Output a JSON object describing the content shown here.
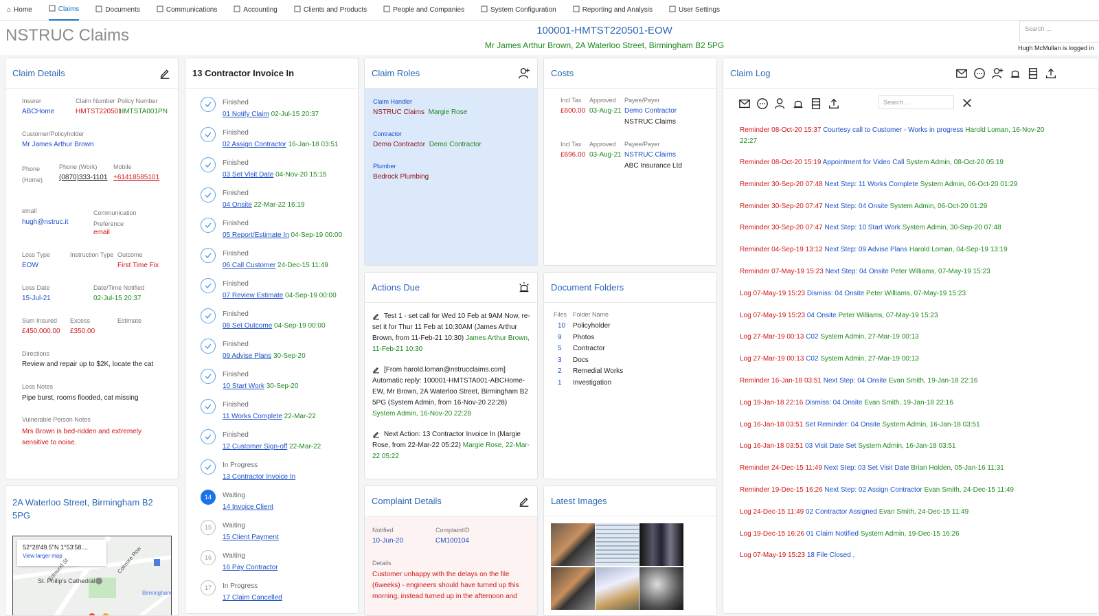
{
  "nav": [
    {
      "label": "Home",
      "icon": "home-icon"
    },
    {
      "label": "Claims",
      "icon": "claims-icon"
    },
    {
      "label": "Documents",
      "icon": "documents-icon"
    },
    {
      "label": "Communications",
      "icon": "communications-icon"
    },
    {
      "label": "Accounting",
      "icon": "accounting-icon"
    },
    {
      "label": "Clients and Products",
      "icon": "clients-icon"
    },
    {
      "label": "People and Companies",
      "icon": "people-icon"
    },
    {
      "label": "System Configuration",
      "icon": "gear-icon"
    },
    {
      "label": "Reporting and Analysis",
      "icon": "chart-icon"
    },
    {
      "label": "User Settings",
      "icon": "gear-icon"
    }
  ],
  "header": {
    "app_title": "NSTRUC Claims",
    "claim_id": "100001-HMTST220501-EOW",
    "claim_address": "Mr James Arthur Brown, 2A Waterloo Street, Birmingham B2 5PG",
    "search_placeholder": "Search ...",
    "logged_in": "Hugh McMullan is logged in"
  },
  "claim_details": {
    "title": "Claim Details",
    "insurer_label": "Insurer",
    "insurer": "ABCHome",
    "claim_number_label": "Claim Number",
    "claim_number": "HMTST220501",
    "policy_number_label": "Policy Number",
    "policy_number": "HMTSTA001PN",
    "customer_label": "Customer/Policyholder",
    "customer": "Mr James Arthur Brown",
    "phone_home_label": "Phone (Home)",
    "phone_work_label": "Phone (Work)",
    "phone_work": "(0870)333-1101",
    "mobile_label": "Mobile",
    "mobile": "+61418585101",
    "email_label": "email",
    "email": "hugh@nstruc.it",
    "comm_pref_label": "Communication Preference",
    "comm_pref": "email",
    "loss_type_label": "Loss Type",
    "loss_type": "EOW",
    "instruction_label": "Instruction Type",
    "outcome_label": "Outcome",
    "outcome": "First Time Fix",
    "loss_date_label": "Loss Date",
    "loss_date": "15-Jul-21",
    "notified_label": "Date/Time Notified",
    "notified": "02-Jul-15 20:37",
    "sum_insured_label": "Sum Insured",
    "sum_insured": "£450,000.00",
    "excess_label": "Excess",
    "excess": "£350.00",
    "estimate_label": "Estimate",
    "directions_label": "Directions",
    "directions": "Review and repair up to $2K, locate the cat",
    "loss_notes_label": "Loss Notes",
    "loss_notes": "Pipe burst, rooms flooded, cat missing",
    "vuln_label": "Vulnerable Person Notes",
    "vuln": "Mrs Brown is bed-ridden and extremely sensitive to noise."
  },
  "address_panel": {
    "title": "2A Waterloo Street, Birmingham B2 5PG",
    "coords": "52°28'49.5\"N 1°53'58....",
    "larger_map": "View larger map",
    "map_label_1": "Colmore Row",
    "map_label_2": "St. Philip's Cathedral",
    "map_label_3": "Birmingham",
    "map_label_4": "Edmund St"
  },
  "workflow": {
    "title": "13 Contractor Invoice In",
    "steps": [
      {
        "status": "Finished",
        "name": "01 Notify Claim",
        "date": "02-Jul-15 20:37"
      },
      {
        "status": "Finished",
        "name": "02 Assign Contractor",
        "date": "16-Jan-18 03:51"
      },
      {
        "status": "Finished",
        "name": "03 Set Visit Date",
        "date": "04-Nov-20 15:15"
      },
      {
        "status": "Finished",
        "name": "04 Onsite",
        "date": "22-Mar-22 16:19"
      },
      {
        "status": "Finished",
        "name": "05 Report/Estimate In",
        "date": "04-Sep-19 00:00"
      },
      {
        "status": "Finished",
        "name": "06 Call Customer",
        "date": "24-Dec-15 11:49"
      },
      {
        "status": "Finished",
        "name": "07 Review Estimate",
        "date": "04-Sep-19 00:00"
      },
      {
        "status": "Finished",
        "name": "08 Set Outcome",
        "date": "04-Sep-19 00:00"
      },
      {
        "status": "Finished",
        "name": "09 Advise Plans",
        "date": "30-Sep-20"
      },
      {
        "status": "Finished",
        "name": "10 Start Work",
        "date": "30-Sep-20"
      },
      {
        "status": "Finished",
        "name": "11 Works Complete",
        "date": "22-Mar-22"
      },
      {
        "status": "Finished",
        "name": "12 Customer Sign-off",
        "date": "22-Mar-22"
      },
      {
        "status": "In Progress",
        "name": "13 Contractor Invoice In",
        "date": ""
      },
      {
        "status": "Waiting",
        "name": "14 Invoice Client",
        "date": "",
        "num": "14"
      },
      {
        "status": "Waiting",
        "name": "15 Client Payment",
        "date": "",
        "num": "15"
      },
      {
        "status": "Waiting",
        "name": "16 Pay Contractor",
        "date": "",
        "num": "16"
      },
      {
        "status": "In Progress",
        "name": "17 Claim Cancelled",
        "date": "",
        "num": "17"
      }
    ]
  },
  "claim_roles": {
    "title": "Claim Roles",
    "roles": [
      {
        "role": "Claim Handler",
        "org": "NSTRUC Claims",
        "person": "Margie Rose"
      },
      {
        "role": "Contractor",
        "org": "Demo Contractor",
        "person": "Demo Contractor"
      },
      {
        "role": "Plumber",
        "org": "Bedrock Plumbing",
        "person": ""
      }
    ]
  },
  "costs": {
    "title": "Costs",
    "incl_tax_label": "Incl Tax",
    "approved_label": "Approved",
    "payee_label": "Payee/Payer",
    "items": [
      {
        "amount": "£600.00",
        "approved": "03-Aug-21",
        "payee": "Demo Contractor",
        "payer": "NSTRUC Claims"
      },
      {
        "amount": "£696.00",
        "approved": "03-Aug-21",
        "payee": "NSTRUC Claims",
        "payer": "ABC Insurance Ltd"
      }
    ]
  },
  "actions_due": {
    "title": "Actions Due",
    "items": [
      {
        "text": "Test 1 - set call for Wed 10 Feb at 9AM Now, re-set it for Thur 11 Feb at 10:30AM (James Arthur Brown, from 11-Feb-21 10:30)",
        "tail": "James Arthur Brown, 11-Feb-21 10:30"
      },
      {
        "text": "[From harold.loman@nstrucclaims.com] Automatic reply: 100001-HMTSTA001-ABCHome-EW, Mr Brown, 2A Waterloo Street, Birmingham B2 5PG (System Admin, from 16-Nov-20 22:28)",
        "tail": "System Admin, 16-Nov-20 22:28"
      },
      {
        "text": "Next Action: 13 Contractor Invoice In (Margie Rose, from 22-Mar-22 05:22)",
        "tail": "Margie Rose, 22-Mar-22 05:22"
      }
    ]
  },
  "document_folders": {
    "title": "Document Folders",
    "files_label": "Files",
    "folder_label": "Folder Name",
    "rows": [
      {
        "count": "10",
        "name": "Policyholder"
      },
      {
        "count": "9",
        "name": "Photos"
      },
      {
        "count": "5",
        "name": "Contractor"
      },
      {
        "count": "3",
        "name": "Docs"
      },
      {
        "count": "2",
        "name": "Remedial Works"
      },
      {
        "count": "1",
        "name": "Investigation"
      }
    ]
  },
  "complaint": {
    "title": "Complaint Details",
    "notified_label": "Notified",
    "notified": "10-Jun-20",
    "id_label": "ComplaintID",
    "id": "CM100104",
    "details_label": "Details",
    "details": "Customer unhappy with the delays on the file (6weeks) - engineers should have turned up this morning, instead turned up in the afternoon and"
  },
  "latest_images": {
    "title": "Latest Images"
  },
  "claim_log": {
    "title": "Claim Log",
    "search_placeholder": "Search ...",
    "entries": [
      {
        "type": "Reminder",
        "time": "08-Oct-20 15:37",
        "desc": "Courtesy call to Customer - Works in progress",
        "by": "Harold Loman, 16-Nov-20 22:27"
      },
      {
        "type": "Reminder",
        "time": "08-Oct-20 15:19",
        "desc": "Appointment for Video Call",
        "by": "System Admin, 08-Oct-20 05:19"
      },
      {
        "type": "Reminder",
        "time": "30-Sep-20 07:48",
        "desc": "Next Step: 11 Works Complete",
        "by": "System Admin, 06-Oct-20 01:29"
      },
      {
        "type": "Reminder",
        "time": "30-Sep-20 07:47",
        "desc": "Next Step: 04 Onsite",
        "by": "System Admin, 06-Oct-20 01:29"
      },
      {
        "type": "Reminder",
        "time": "30-Sep-20 07:47",
        "desc": "Next Step: 10 Start Work",
        "by": "System Admin, 30-Sep-20 07:48"
      },
      {
        "type": "Reminder",
        "time": "04-Sep-19 13:12",
        "desc": "Next Step: 09 Advise Plans",
        "by": "Harold Loman, 04-Sep-19 13:19"
      },
      {
        "type": "Reminder",
        "time": "07-May-19 15:23",
        "desc": "Next Step: 04 Onsite",
        "by": "Peter Williams, 07-May-19 15:23"
      },
      {
        "type": "Log",
        "time": "07-May-19 15:23",
        "desc": "Dismiss: 04 Onsite",
        "by": "Peter Williams, 07-May-19 15:23"
      },
      {
        "type": "Log",
        "time": "07-May-19 15:23",
        "desc": "04 Onsite",
        "by": "Peter Williams, 07-May-19 15:23"
      },
      {
        "type": "Log",
        "time": "27-Mar-19 00:13",
        "desc": "C02",
        "by": "System Admin, 27-Mar-19 00:13"
      },
      {
        "type": "Log",
        "time": "27-Mar-19 00:13",
        "desc": "C02",
        "by": "System Admin, 27-Mar-19 00:13"
      },
      {
        "type": "Reminder",
        "time": "16-Jan-18 03:51",
        "desc": "Next Step: 04 Onsite",
        "by": "Evan Smith, 19-Jan-18 22:16"
      },
      {
        "type": "Log",
        "time": "19-Jan-18 22:16",
        "desc": "Dismiss: 04 Onsite",
        "by": "Evan Smith, 19-Jan-18 22:16"
      },
      {
        "type": "Log",
        "time": "16-Jan-18 03:51",
        "desc": "Set Reminder: 04 Onsite",
        "by": "System Admin, 16-Jan-18 03:51"
      },
      {
        "type": "Log",
        "time": "16-Jan-18 03:51",
        "desc": "03 Visit Date Set",
        "by": "System Admin, 16-Jan-18 03:51"
      },
      {
        "type": "Reminder",
        "time": "24-Dec-15 11:49",
        "desc": "Next Step: 03 Set Visit Date",
        "by": "Brian Holden, 05-Jan-16 11:31"
      },
      {
        "type": "Reminder",
        "time": "19-Dec-15 16:26",
        "desc": "Next Step: 02 Assign Contractor",
        "by": "Evan Smith, 24-Dec-15 11:49"
      },
      {
        "type": "Log",
        "time": "24-Dec-15 11:49",
        "desc": "02 Contractor Assigned",
        "by": "Evan Smith, 24-Dec-15 11:49"
      },
      {
        "type": "Log",
        "time": "19-Dec-15 16:26",
        "desc": "01 Claim Notified",
        "by": "System Admin, 19-Dec-15 16:26"
      },
      {
        "type": "Log",
        "time": "07-May-19 15:23",
        "desc": "18 File Closed",
        "by": ","
      }
    ]
  },
  "colors": {
    "blue": "#1a4fc8",
    "red": "#d01616",
    "green": "#1e8a1e",
    "title_blue": "#2a67b6",
    "roles_bg": "#dce9fb",
    "complaint_bg": "#fdf3f3"
  }
}
